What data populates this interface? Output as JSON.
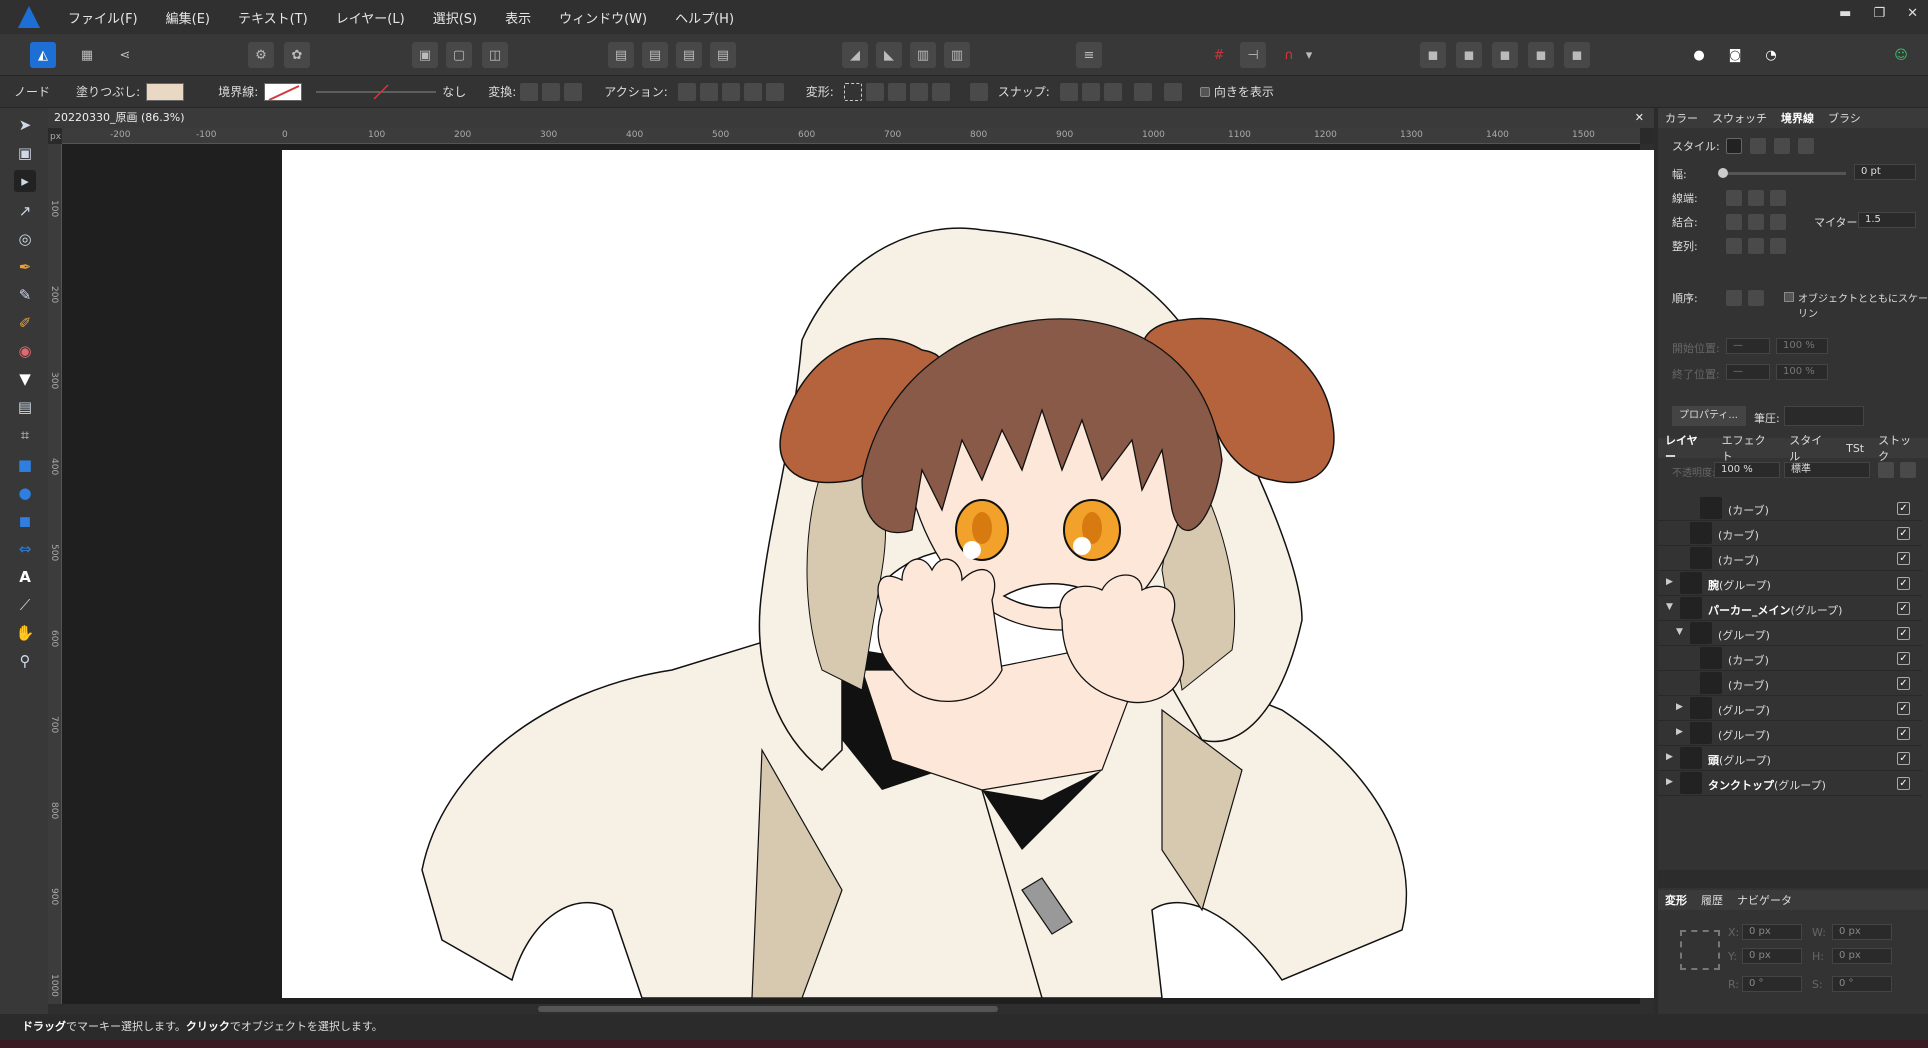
{
  "menubar": {
    "items": [
      "ファイル(F)",
      "編集(E)",
      "テキスト(T)",
      "レイヤー(L)",
      "選択(S)",
      "表示",
      "ウィンドウ(W)",
      "ヘルプ(H)"
    ]
  },
  "context_toolbar": {
    "node_label": "ノード",
    "fill_label": "塗りつぶし:",
    "fill_color": "#e8d8c4",
    "stroke_label": "境界線:",
    "stroke_value": "なし",
    "transform_label": "変換:",
    "action_label": "アクション:",
    "deform_label": "変形:",
    "snap_label": "スナップ:",
    "show_direction_label": "向きを表示"
  },
  "document": {
    "title": "20220330_原画 (86.3%)",
    "ruler_unit": "px",
    "h_ruler_ticks": [
      "-200",
      "-100",
      "0",
      "100",
      "200",
      "300",
      "400",
      "500",
      "600",
      "700",
      "800",
      "900",
      "1000",
      "1100",
      "1200",
      "1300",
      "1400",
      "1500"
    ],
    "v_ruler_ticks": [
      "100",
      "200",
      "300",
      "400",
      "500",
      "600",
      "700",
      "800",
      "900",
      "1000"
    ]
  },
  "stroke_panel": {
    "tabs": [
      "カラー",
      "スウォッチ",
      "境界線",
      "ブラシ"
    ],
    "active_tab": "境界線",
    "style_label": "スタイル:",
    "width_label": "幅:",
    "width_value": "0 pt",
    "cap_label": "線端:",
    "join_label": "結合:",
    "miter_label": "マイター:",
    "miter_value": "1.5",
    "align_label": "整列:",
    "order_label": "順序:",
    "scale_with_object": "オブジェクトとともにスケーリン",
    "start_label": "開始位置:",
    "end_label": "終了位置:",
    "start_pct": "100 %",
    "end_pct": "100 %",
    "properties_button": "プロパティ...",
    "pressure_label": "筆圧:"
  },
  "layers_panel": {
    "tabs": [
      "レイヤー",
      "エフェクト",
      "スタイル",
      "TSt",
      "ストック"
    ],
    "active_tab": "レイヤー",
    "opacity_label": "不透明度:",
    "opacity_value": "100 %",
    "blend_mode": "標準",
    "rows": [
      {
        "name": "",
        "type": "(カーブ)",
        "expander": "",
        "indent": 2
      },
      {
        "name": "",
        "type": "(カーブ)",
        "expander": "",
        "indent": 1
      },
      {
        "name": "",
        "type": "(カーブ)",
        "expander": "",
        "indent": 1
      },
      {
        "name": "腕",
        "type": "(グループ)",
        "expander": "▶",
        "indent": 0
      },
      {
        "name": "パーカー_メイン",
        "type": "(グループ)",
        "expander": "▼",
        "indent": 0
      },
      {
        "name": "",
        "type": "(グループ)",
        "expander": "▼",
        "indent": 1
      },
      {
        "name": "",
        "type": "(カーブ)",
        "expander": "",
        "indent": 2
      },
      {
        "name": "",
        "type": "(カーブ)",
        "expander": "",
        "indent": 2
      },
      {
        "name": "",
        "type": "(グループ)",
        "expander": "▶",
        "indent": 1
      },
      {
        "name": "",
        "type": "(グループ)",
        "expander": "▶",
        "indent": 1
      },
      {
        "name": "頭",
        "type": "(グループ)",
        "expander": "▶",
        "indent": 0
      },
      {
        "name": "タンクトップ",
        "type": "(グループ)",
        "expander": "▶",
        "indent": 0
      }
    ]
  },
  "transform_panel": {
    "tabs": [
      "変形",
      "履歴",
      "ナビゲータ"
    ],
    "active_tab": "変形",
    "x_label": "X:",
    "x_value": "0 px",
    "y_label": "Y:",
    "y_value": "0 px",
    "w_label": "W:",
    "w_value": "0 px",
    "h_label": "H:",
    "h_value": "0 px",
    "r_label": "R:",
    "r_value": "0 °",
    "s_label": "S:",
    "s_value": "0 °"
  },
  "statusbar": {
    "drag_bold": "ドラッグ",
    "drag_text": "でマーキー選択します。",
    "click_bold": "クリック",
    "click_text": "でオブジェクトを選択します。"
  },
  "colors": {
    "accent": "#1d6fd6",
    "hoodie": "#f7f0e4",
    "hoodie_shadow": "#d7c8b0",
    "ears": "#b5633c",
    "hair": "#8a5a48",
    "skin": "#fde7d9",
    "eyes": "#f2a12b"
  }
}
